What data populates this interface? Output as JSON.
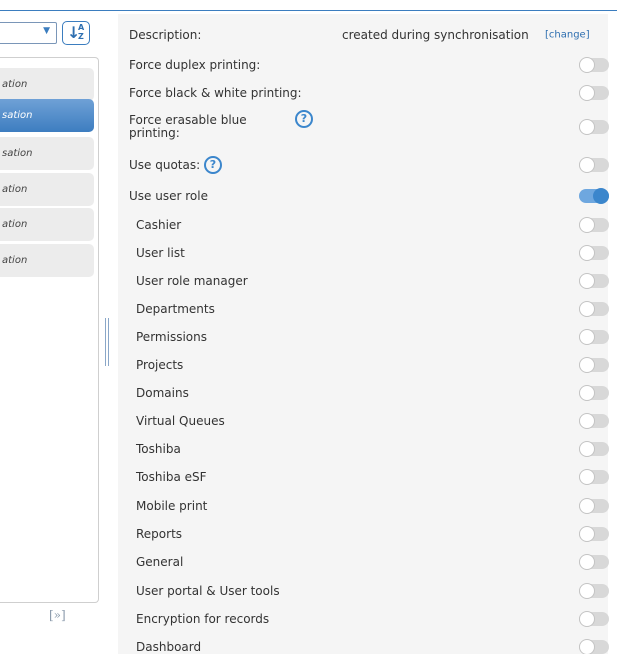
{
  "left_panel": {
    "filter_arrow": "▼",
    "sort_button": {
      "icon": "sort-az-icon",
      "letters_top": "A",
      "letters_bottom": "Z",
      "arrow": "↓"
    },
    "list_items": [
      {
        "label": "ation",
        "selected": false
      },
      {
        "label": "sation",
        "selected": true
      },
      {
        "label": "sation",
        "selected": false
      },
      {
        "label": "ation",
        "selected": false
      },
      {
        "label": "ation",
        "selected": false
      },
      {
        "label": "ation",
        "selected": false
      }
    ],
    "expand_label": "[»]"
  },
  "settings": {
    "description": {
      "label": "Description:",
      "value": "created during synchronisation",
      "change_link": "[change]"
    },
    "rows": [
      {
        "label": "Force duplex printing:",
        "on": false
      },
      {
        "label": "Force black & white printing:",
        "on": false
      },
      {
        "label": "Force erasable blue printing:",
        "on": false,
        "help": "?"
      },
      {
        "label": "Use quotas:",
        "on": false,
        "help": "?"
      },
      {
        "label": "Use user role",
        "on": true
      }
    ],
    "role_items": [
      {
        "label": "Cashier",
        "on": false
      },
      {
        "label": "User list",
        "on": false
      },
      {
        "label": "User role manager",
        "on": false
      },
      {
        "label": "Departments",
        "on": false
      },
      {
        "label": "Permissions",
        "on": false
      },
      {
        "label": "Projects",
        "on": false
      },
      {
        "label": "Domains",
        "on": false
      },
      {
        "label": "Virtual Queues",
        "on": false
      },
      {
        "label": "Toshiba",
        "on": false
      },
      {
        "label": "Toshiba eSF",
        "on": false
      },
      {
        "label": "Mobile print",
        "on": false
      },
      {
        "label": "Reports",
        "on": false
      },
      {
        "label": "General",
        "on": false
      },
      {
        "label": "User portal & User tools",
        "on": false
      },
      {
        "label": "Encryption for records",
        "on": false
      },
      {
        "label": "Dashboard",
        "on": false
      }
    ]
  },
  "colors": {
    "accent": "#3b86cc",
    "selected_item": "#4f8bca",
    "panel_bg": "#f5f5f5",
    "toggle_off": "#d8d8d8"
  }
}
